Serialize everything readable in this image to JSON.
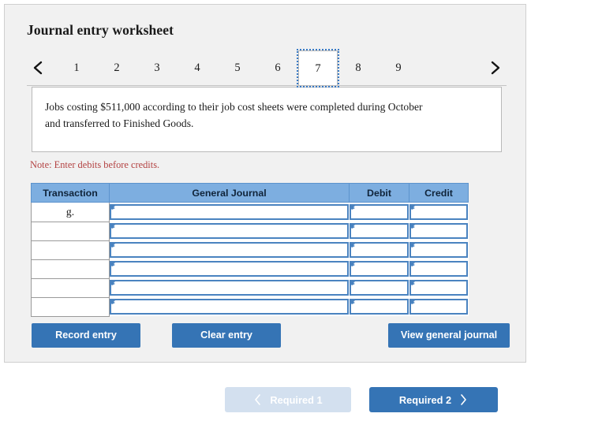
{
  "worksheet": {
    "title": "Journal entry worksheet",
    "nav": {
      "prev_icon": "chevron-left-icon",
      "next_icon": "chevron-right-icon"
    },
    "tabs": [
      {
        "label": "1",
        "active": false
      },
      {
        "label": "2",
        "active": false
      },
      {
        "label": "3",
        "active": false
      },
      {
        "label": "4",
        "active": false
      },
      {
        "label": "5",
        "active": false
      },
      {
        "label": "6",
        "active": false
      },
      {
        "label": "7",
        "active": true
      },
      {
        "label": "8",
        "active": false
      },
      {
        "label": "9",
        "active": false
      }
    ],
    "description": "Jobs costing $511,000 according to their job cost sheets were completed during October and transferred to Finished Goods.",
    "note": "Note: Enter debits before credits.",
    "table": {
      "headers": [
        "Transaction",
        "General Journal",
        "Debit",
        "Credit"
      ],
      "rows": [
        {
          "transaction": "g.",
          "general_journal": "",
          "debit": "",
          "credit": ""
        },
        {
          "transaction": "",
          "general_journal": "",
          "debit": "",
          "credit": ""
        },
        {
          "transaction": "",
          "general_journal": "",
          "debit": "",
          "credit": ""
        },
        {
          "transaction": "",
          "general_journal": "",
          "debit": "",
          "credit": ""
        },
        {
          "transaction": "",
          "general_journal": "",
          "debit": "",
          "credit": ""
        },
        {
          "transaction": "",
          "general_journal": "",
          "debit": "",
          "credit": ""
        }
      ]
    },
    "actions": {
      "record": "Record entry",
      "clear": "Clear entry",
      "view": "View general journal"
    }
  },
  "footer_nav": {
    "prev_label": "Required 1",
    "next_label": "Required 2",
    "prev_icon": "chevron-left-icon",
    "next_icon": "chevron-right-icon",
    "prev_disabled": true
  },
  "colors": {
    "accent_blue": "#3574b5",
    "header_blue": "#7daee0",
    "field_border_blue": "#4a83c0",
    "disabled_blue": "#d3e0ef",
    "note_red": "#b34242",
    "panel_bg": "#f1f1f1"
  }
}
